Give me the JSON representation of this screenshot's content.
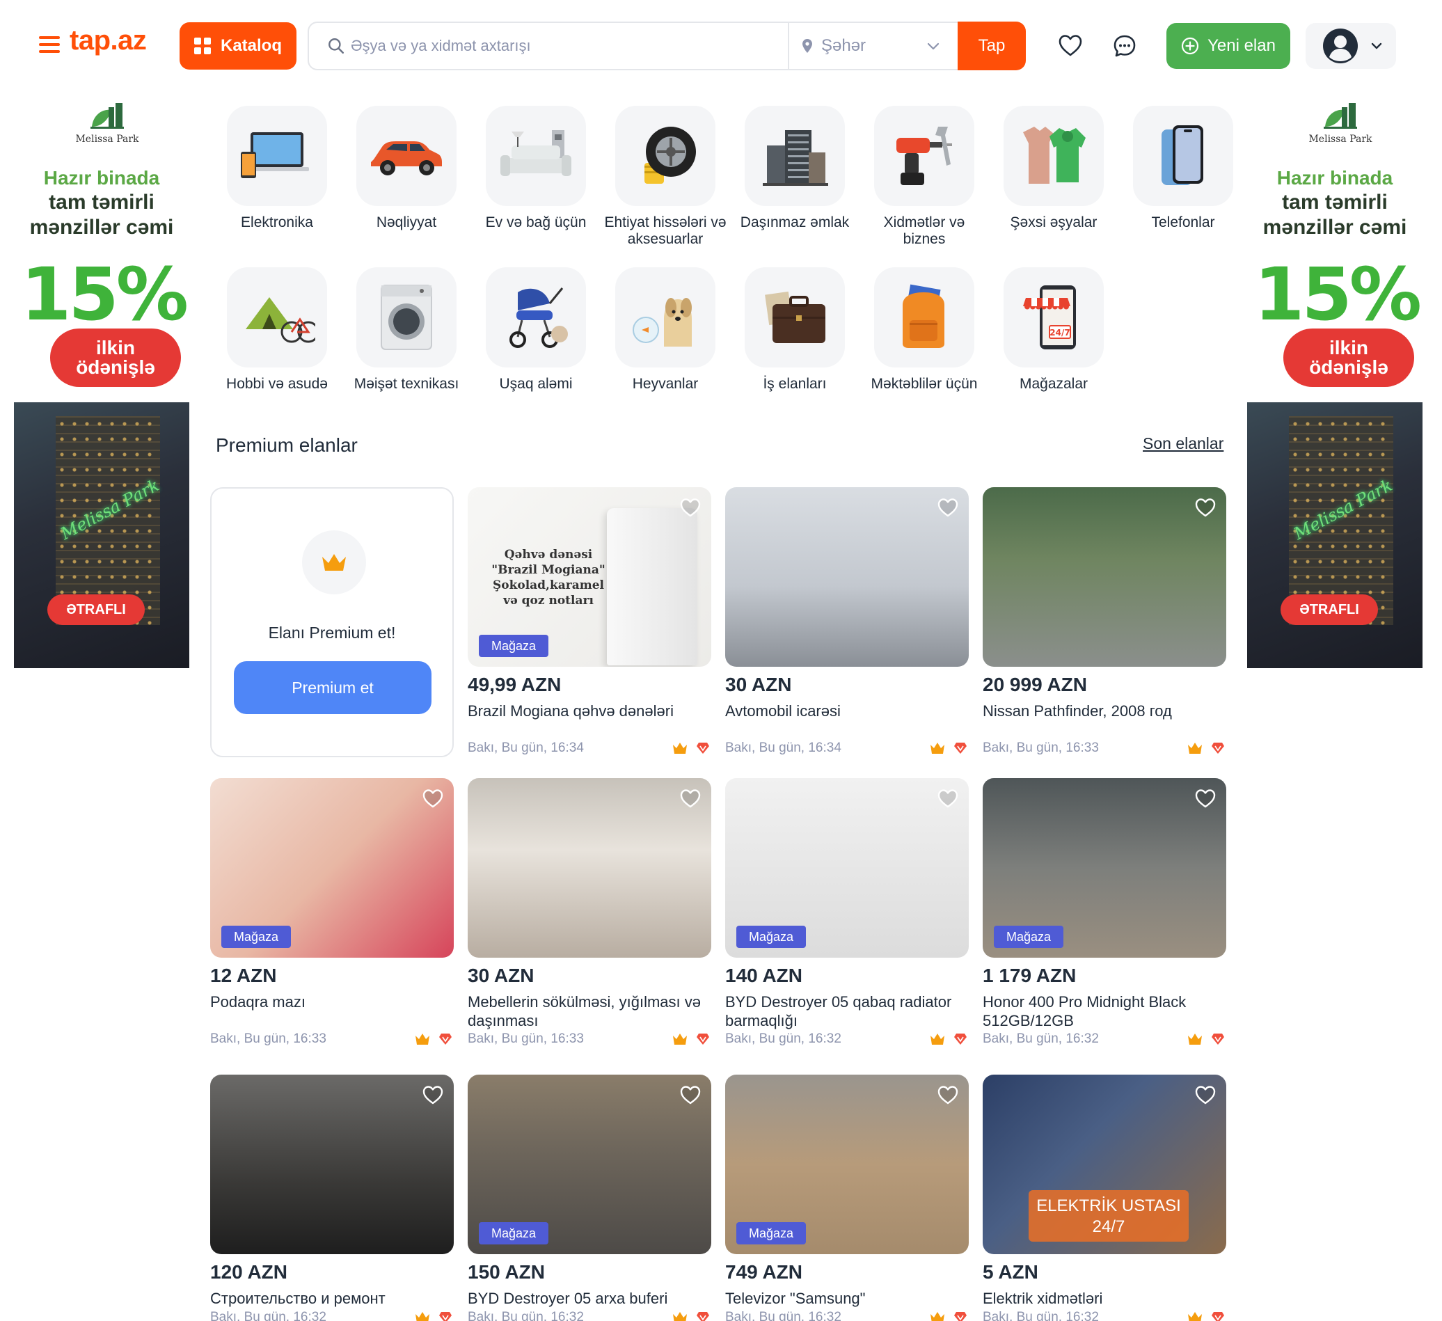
{
  "header": {
    "logo": "tap.az",
    "katalog_label": "Kataloq",
    "search_placeholder": "Əşya və ya xidmət axtarışı",
    "city_label": "Şəhər",
    "search_button": "Tap",
    "new_ad_label": "Yeni elan"
  },
  "side_banner": {
    "brand": "Melissa Park",
    "line1": "Hazır binada",
    "line2": "tam təmirli",
    "line3": "mənzillər cəmi",
    "percent": "15%",
    "pill_line1": "ilkin",
    "pill_line2": "ödənişlə",
    "sign": "Melissa Park",
    "cta": "ƏTRAFLI"
  },
  "categories": [
    {
      "label": "Elektronika",
      "icon": "laptop-icon"
    },
    {
      "label": "Nəqliyyat",
      "icon": "car-icon"
    },
    {
      "label": "Ev və bağ üçün",
      "icon": "sofa-icon"
    },
    {
      "label": "Ehtiyat hissələri və aksesuarlar",
      "icon": "wheel-icon"
    },
    {
      "label": "Daşınmaz əmlak",
      "icon": "building-icon"
    },
    {
      "label": "Xidmətlər və biznes",
      "icon": "drill-icon"
    },
    {
      "label": "Şəxsi əşyalar",
      "icon": "clothes-icon"
    },
    {
      "label": "Telefonlar",
      "icon": "phone-icon"
    },
    {
      "label": "Hobbi və asudə",
      "icon": "tent-icon"
    },
    {
      "label": "Məişət texnikası",
      "icon": "washing-machine-icon"
    },
    {
      "label": "Uşaq aləmi",
      "icon": "stroller-icon"
    },
    {
      "label": "Heyvanlar",
      "icon": "dog-icon"
    },
    {
      "label": "İş elanları",
      "icon": "briefcase-icon"
    },
    {
      "label": "Məktəblilər üçün",
      "icon": "backpack-icon"
    },
    {
      "label": "Mağazalar",
      "icon": "store-icon"
    }
  ],
  "premium": {
    "title": "Premium elanlar",
    "latest_link": "Son elanlar",
    "promo_text": "Elanı Premium et!",
    "promo_button": "Premium et"
  },
  "badge_label": "Mağaza",
  "listings": [
    {
      "price": "49,99 AZN",
      "title": "Brazil Mogiana qəhvə dənələri",
      "meta": "Bakı, Bu gün, 16:34",
      "store": true,
      "img": "img-coffee",
      "overlay": "Qəhvə dənəsi \"Brazil Mogiana\" Şokolad,karamel və qoz notları"
    },
    {
      "price": "30 AZN",
      "title": "Avtomobil icarəsi",
      "meta": "Bakı, Bu gün, 16:34",
      "store": false,
      "img": "img-car1",
      "overlay": ""
    },
    {
      "price": "20 999 AZN",
      "title": "Nissan Pathfinder, 2008 год",
      "meta": "Bakı, Bu gün, 16:33",
      "store": false,
      "img": "img-car2",
      "overlay": ""
    },
    {
      "price": "12 AZN",
      "title": "Podaqra mazı",
      "meta": "Bakı, Bu gün, 16:33",
      "store": true,
      "img": "img-feet",
      "overlay": ""
    },
    {
      "price": "30 AZN",
      "title": "Mebellerin sökülməsi, yığılması və daşınması",
      "meta": "Bakı, Bu gün, 16:33",
      "store": false,
      "img": "img-wardrobe",
      "overlay": ""
    },
    {
      "price": "140 AZN",
      "title": "BYD Destroyer 05 qabaq radiator barmaqlığı",
      "meta": "Bakı, Bu gün, 16:32",
      "store": true,
      "img": "img-grille",
      "overlay": ""
    },
    {
      "price": "1 179 AZN",
      "title": "Honor 400 Pro Midnight Black 512GB/12GB",
      "meta": "Bakı, Bu gün, 16:32",
      "store": true,
      "img": "img-phone",
      "overlay": ""
    },
    {
      "price": "120 AZN",
      "title": "Строительство и ремонт",
      "meta": "Bakı, Bu gün, 16:32",
      "store": false,
      "img": "img-worker",
      "overlay": ""
    },
    {
      "price": "150 AZN",
      "title": "BYD Destroyer 05 arxa buferi",
      "meta": "Bakı, Bu gün, 16:32",
      "store": true,
      "img": "img-bumper",
      "overlay": ""
    },
    {
      "price": "749 AZN",
      "title": "Televizor \"Samsung\"",
      "meta": "Bakı, Bu gün, 16:32",
      "store": true,
      "img": "img-tv",
      "overlay": ""
    },
    {
      "price": "5 AZN",
      "title": "Elektrik xidmətləri",
      "meta": "Bakı, Bu gün, 16:32",
      "store": false,
      "img": "img-elec",
      "overlay": "ELEKTRİK USTASI 24/7"
    }
  ],
  "colors": {
    "brand": "#ff4f08",
    "green": "#4caf50",
    "blue": "#4f86f7",
    "badge": "#4f5bd5"
  }
}
